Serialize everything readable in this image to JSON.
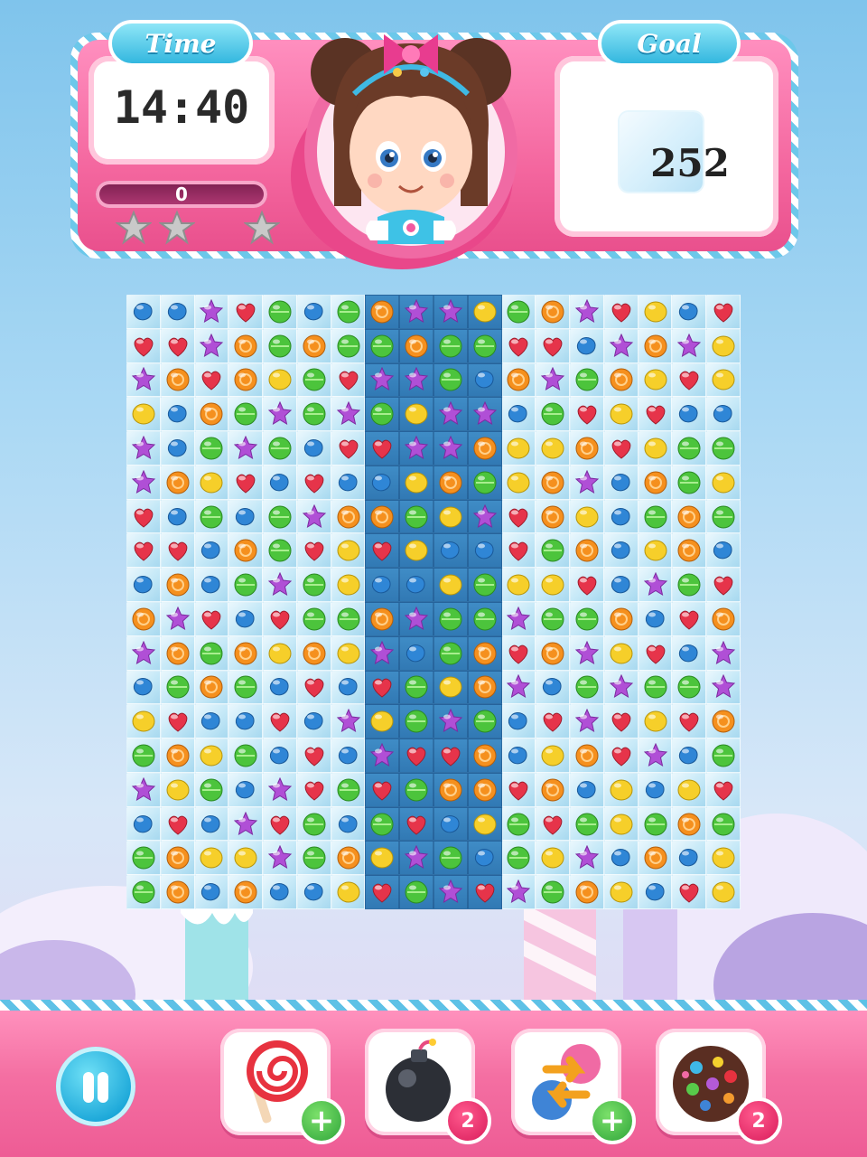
{
  "header": {
    "time_label": "Time",
    "time_value": "14:40",
    "goal_label": "Goal",
    "goal_value": "252",
    "score_value": "0",
    "stars_earned": 0,
    "stars_total": 3
  },
  "colors": {
    "header_pink": "#f4679f",
    "tag_blue": "#33b7df",
    "footer_pink": "#f46fa2",
    "board_blue": "#3f8cc6"
  },
  "board": {
    "rows": 18,
    "cols": 18,
    "plain_columns": [
      7,
      8,
      9,
      10
    ],
    "legend": {
      "B": "blue-bean-candy",
      "P": "purple-star-candy",
      "R": "red-heart-candy",
      "G": "green-round-candy",
      "O": "orange-swirl-candy",
      "Y": "yellow-drop-candy"
    },
    "grid": [
      "BBPRGBGOPPYGOPRYBR",
      "RRPOGOGGOGGRRBPOPY",
      "POROYGRPPGBOPGOYRY",
      "YBOGPGPGYPPBGRYRBB",
      "PBGPGBRRPPOYYORYGG",
      "POYRBRBBYOGYOPBOGY",
      "RBGBGPOOGYPROYBGOG",
      "RRBOGRYRYBBRGOBYOB",
      "BOBGPGYBBYGYYRBPGR",
      "OPRBRGGOPGGPGGOBRO",
      "POGOYOYPBGOROPYRBP",
      "BGOGBRBRGYOPBGPGGP",
      "YRBBRBPYGPGBRPRYRO",
      "GOYGBRBPRROBYORPBG",
      "PYGBPRGRGOOROBYBYR",
      "BRBPRGBGRBYGRGYGOG",
      "GOYYPGOYPGBGYPBOBY",
      "GOBOBBYRGPRPGOYBRY"
    ]
  },
  "boosters": [
    {
      "name": "lollipop-hammer",
      "icon": "lollipop-icon",
      "badge": "+"
    },
    {
      "name": "bomb",
      "icon": "bomb-icon",
      "badge": "2"
    },
    {
      "name": "swap",
      "icon": "swap-icon",
      "badge": "+"
    },
    {
      "name": "color-bomb",
      "icon": "color-bomb-icon",
      "badge": "2"
    }
  ]
}
